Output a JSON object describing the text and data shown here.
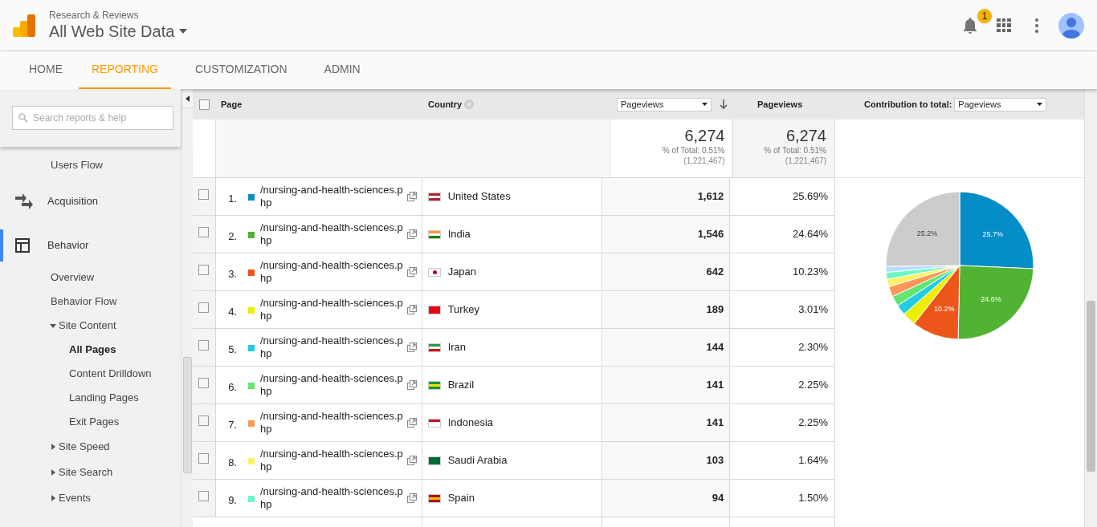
{
  "header": {
    "account": "Research & Reviews",
    "view": "All Web Site Data",
    "notification_count": "1"
  },
  "nav_tabs": [
    {
      "label": "HOME",
      "selected": false
    },
    {
      "label": "REPORTING",
      "selected": true
    },
    {
      "label": "CUSTOMIZATION",
      "selected": false
    },
    {
      "label": "ADMIN",
      "selected": false
    }
  ],
  "sidebar": {
    "search": {
      "placeholder": "Search reports & help"
    },
    "items": [
      {
        "label": "Users Flow",
        "kind": "link",
        "selected": false
      },
      {
        "label": "Acquisition",
        "kind": "section",
        "selected": false
      },
      {
        "label": "Behavior",
        "kind": "section",
        "selected": true,
        "children": [
          {
            "label": "Overview",
            "selected": false
          },
          {
            "label": "Behavior Flow",
            "selected": false
          },
          {
            "label": "Site Content",
            "selected": false,
            "expanded": true,
            "children": [
              {
                "label": "All Pages",
                "selected": true
              },
              {
                "label": "Content Drilldown",
                "selected": false
              },
              {
                "label": "Landing Pages",
                "selected": false
              },
              {
                "label": "Exit Pages",
                "selected": false
              }
            ]
          },
          {
            "label": "Site Speed",
            "selected": false,
            "expanded": false
          },
          {
            "label": "Site Search",
            "selected": false,
            "expanded": false
          },
          {
            "label": "Events",
            "selected": false,
            "expanded": false
          }
        ]
      }
    ]
  },
  "table": {
    "header": {
      "checked": false,
      "page": "Page",
      "country": "Country",
      "metric_select": "Pageviews",
      "pageviews": "Pageviews",
      "contribution_label": "Contribution to total:",
      "contribution_select": "Pageviews"
    },
    "totals": [
      {
        "value": "6,274",
        "share": "% of Total: 0.51%",
        "total": "(1,221,467)"
      },
      {
        "value": "6,274",
        "share": "% of Total: 0.51%",
        "total": "(1,221,467)"
      }
    ],
    "rows": [
      {
        "index": "1.",
        "color": "#058dc7",
        "page": "/nursing-and-health-sciences.php",
        "country": "United States",
        "pageviews": "1,612",
        "percent": "25.69%",
        "checked": false
      },
      {
        "index": "2.",
        "color": "#50b432",
        "page": "/nursing-and-health-sciences.php",
        "country": "India",
        "pageviews": "1,546",
        "percent": "24.64%",
        "checked": false
      },
      {
        "index": "3.",
        "color": "#ed561b",
        "page": "/nursing-and-health-sciences.php",
        "country": "Japan",
        "pageviews": "642",
        "percent": "10.23%",
        "checked": false
      },
      {
        "index": "4.",
        "color": "#edef00",
        "page": "/nursing-and-health-sciences.php",
        "country": "Turkey",
        "pageviews": "189",
        "percent": "3.01%",
        "checked": false
      },
      {
        "index": "5.",
        "color": "#24cbe5",
        "page": "/nursing-and-health-sciences.php",
        "country": "Iran",
        "pageviews": "144",
        "percent": "2.30%",
        "checked": false
      },
      {
        "index": "6.",
        "color": "#64e572",
        "page": "/nursing-and-health-sciences.php",
        "country": "Brazil",
        "pageviews": "141",
        "percent": "2.25%",
        "checked": false
      },
      {
        "index": "7.",
        "color": "#ff9655",
        "page": "/nursing-and-health-sciences.php",
        "country": "Indonesia",
        "pageviews": "141",
        "percent": "2.25%",
        "checked": false
      },
      {
        "index": "8.",
        "color": "#fff263",
        "page": "/nursing-and-health-sciences.php",
        "country": "Saudi Arabia",
        "pageviews": "103",
        "percent": "1.64%",
        "checked": false
      },
      {
        "index": "9.",
        "color": "#6af9c4",
        "page": "/nursing-and-health-sciences.php",
        "country": "Spain",
        "pageviews": "94",
        "percent": "1.50%",
        "checked": false
      }
    ],
    "chart_data": {
      "type": "pie",
      "values": [
        25.69,
        24.64,
        10.23,
        3.01,
        2.3,
        2.25,
        2.25,
        1.64,
        1.5,
        1.29,
        25.2
      ],
      "colors": [
        "#058dc7",
        "#50b432",
        "#ed561b",
        "#edef00",
        "#24cbe5",
        "#64e572",
        "#ff9655",
        "#fff263",
        "#6af9c4",
        "#b2deff",
        "#cccccc"
      ],
      "value_labels": [
        "25.7%",
        "24.6%",
        "10.2%",
        null,
        null,
        null,
        null,
        null,
        null,
        null,
        "25.2%"
      ]
    }
  }
}
